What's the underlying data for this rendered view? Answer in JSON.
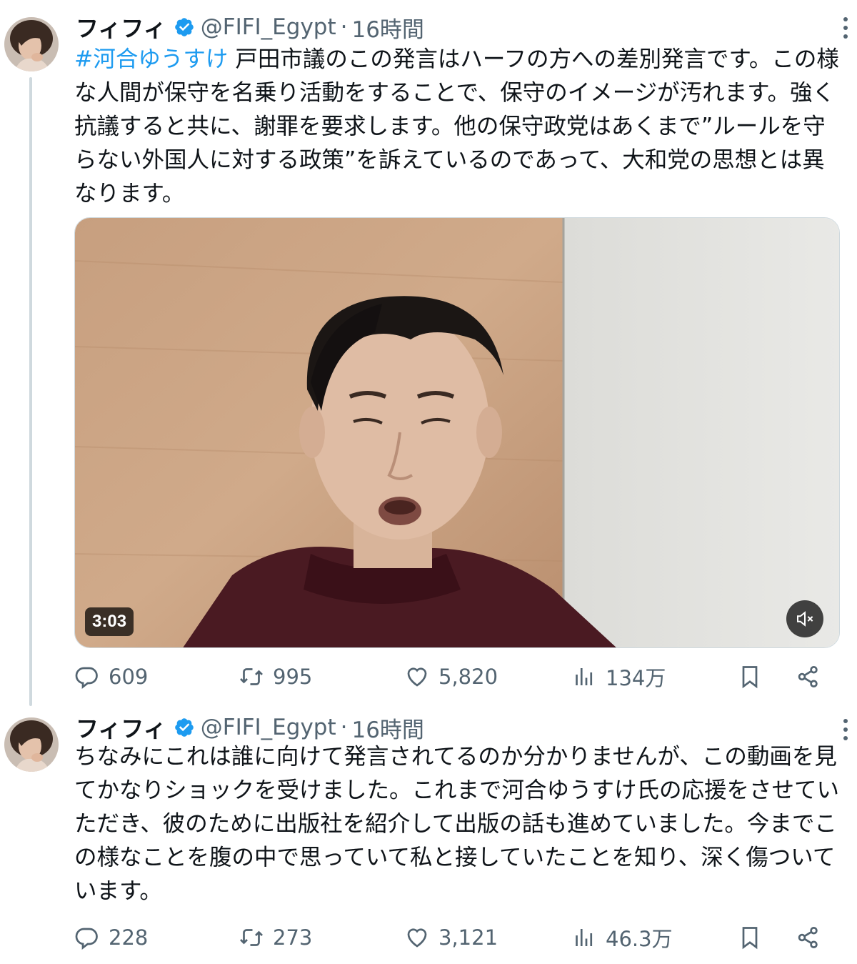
{
  "tweets": [
    {
      "author": {
        "name": "フィフィ",
        "handle": "@FIFI_Egypt",
        "time": "16時間"
      },
      "hashtag": "#河合ゆうすけ",
      "text": " 戸田市議のこの発言はハーフの方への差別発言です。この様な人間が保守を名乗り活動をすることで、保守のイメージが汚れます。強く抗議すると共に、謝罪を要求します。他の保守政党はあくまで”ルールを守らない外国人に対する政策”を訴えているのであって、大和党の思想とは異なります。",
      "video": {
        "duration": "3:03",
        "muted": true
      },
      "stats": {
        "replies": "609",
        "retweets": "995",
        "likes": "5,820",
        "views": "134万"
      }
    },
    {
      "author": {
        "name": "フィフィ",
        "handle": "@FIFI_Egypt",
        "time": "16時間"
      },
      "text": "ちなみにこれは誰に向けて発言されてるのか分かりませんが、この動画を見てかなりショックを受けました。これまで河合ゆうすけ氏の応援をさせていただき、彼のために出版社を紹介して出版の話も進めていました。今までこの様なことを腹の中で思っていて私と接していたことを知り、深く傷ついています。",
      "stats": {
        "replies": "228",
        "retweets": "273",
        "likes": "3,121",
        "views": "46.3万"
      }
    }
  ],
  "icons": {
    "verified": "verified-badge-icon",
    "more": "more-vertical-icon",
    "reply": "reply-icon",
    "retweet": "retweet-icon",
    "like": "heart-icon",
    "views": "views-chart-icon",
    "bookmark": "bookmark-icon",
    "share": "share-icon",
    "mute": "volume-muted-icon"
  },
  "colors": {
    "accent": "#1d9bf0",
    "muted_text": "#536471",
    "text": "#0f1419"
  }
}
